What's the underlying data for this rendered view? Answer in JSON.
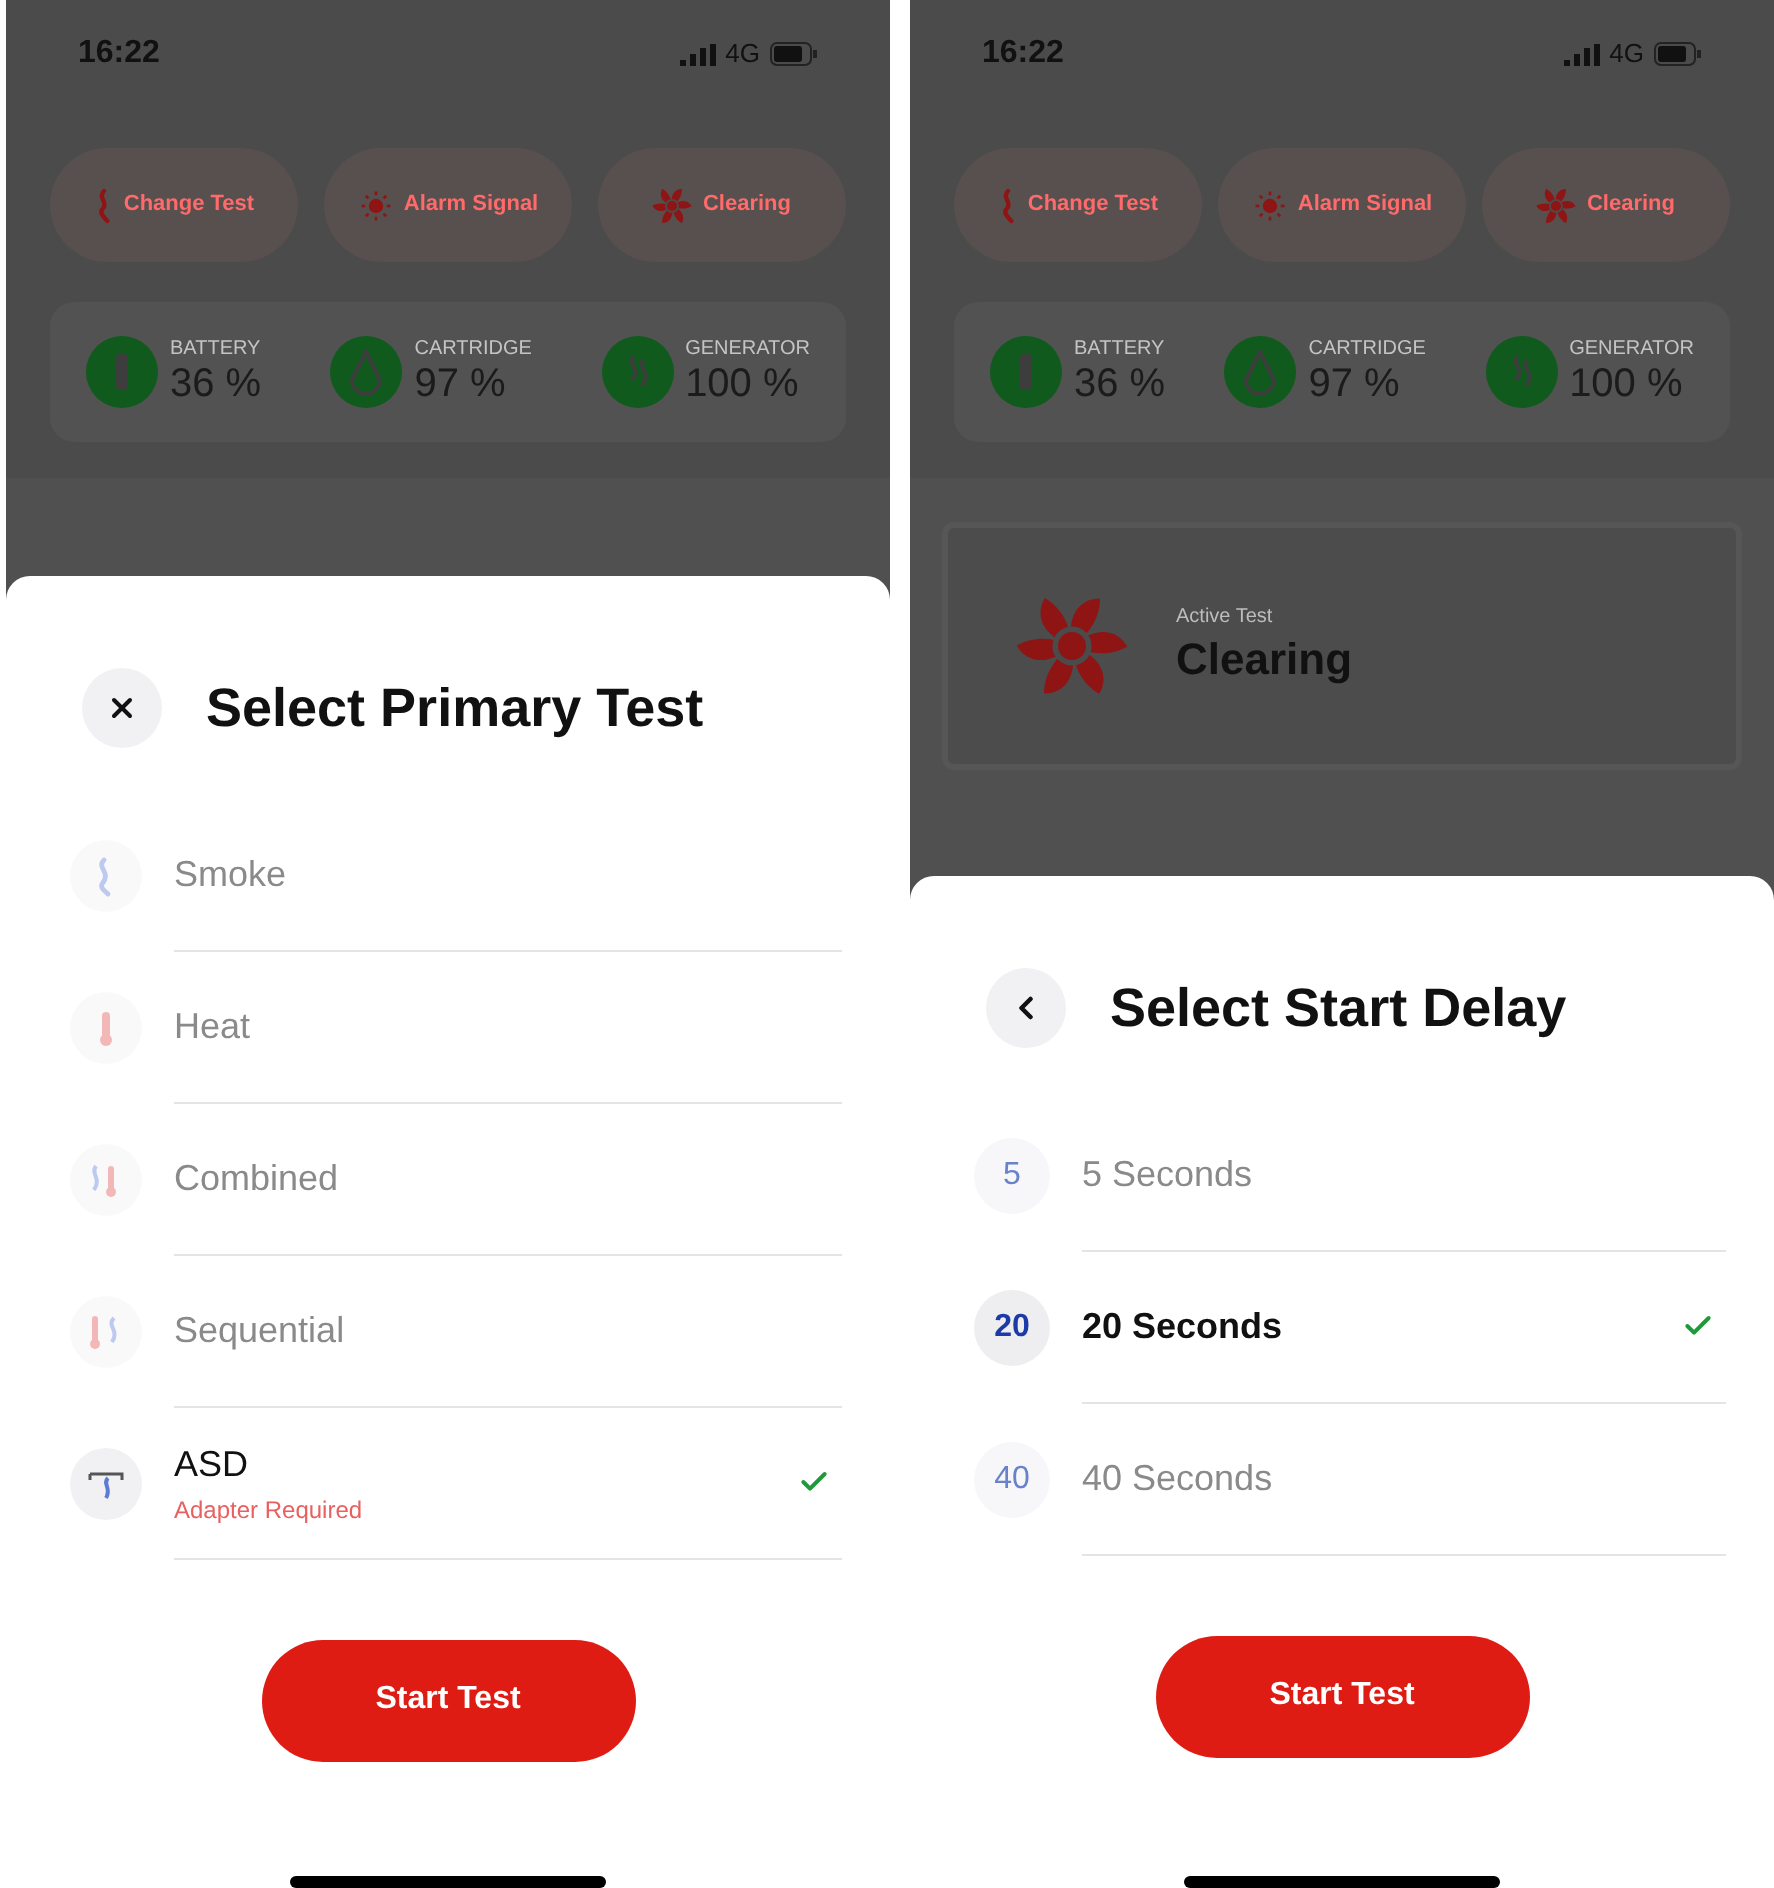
{
  "screens": [
    {
      "status_bar": {
        "time": "16:22",
        "network": "4G"
      },
      "action_buttons": [
        {
          "label": "Change Test"
        },
        {
          "label": "Alarm Signal"
        },
        {
          "label": "Clearing"
        }
      ],
      "stats": [
        {
          "label": "BATTERY",
          "value": "36 %"
        },
        {
          "label": "CARTRIDGE",
          "value": "97 %"
        },
        {
          "label": "GENERATOR",
          "value": "100 %"
        }
      ],
      "sheet": {
        "title": "Select Primary Test",
        "options": [
          {
            "kind": "test",
            "label": "Smoke",
            "selected": false
          },
          {
            "kind": "test",
            "label": "Heat",
            "selected": false
          },
          {
            "kind": "test",
            "label": "Combined",
            "selected": false
          },
          {
            "kind": "test",
            "label": "Sequential",
            "selected": false
          },
          {
            "kind": "test",
            "label": "ASD",
            "note": "Adapter Required",
            "selected": true
          }
        ],
        "button": "Start Test"
      }
    },
    {
      "status_bar": {
        "time": "16:22",
        "network": "4G"
      },
      "action_buttons": [
        {
          "label": "Change Test"
        },
        {
          "label": "Alarm Signal"
        },
        {
          "label": "Clearing"
        }
      ],
      "stats": [
        {
          "label": "BATTERY",
          "value": "36 %"
        },
        {
          "label": "CARTRIDGE",
          "value": "97 %"
        },
        {
          "label": "GENERATOR",
          "value": "100 %"
        }
      ],
      "active_test": {
        "caption": "Active Test",
        "name": "Clearing"
      },
      "sheet": {
        "title": "Select Start Delay",
        "options": [
          {
            "kind": "delay",
            "badge": "5",
            "label": "5 Seconds",
            "selected": false
          },
          {
            "kind": "delay",
            "badge": "20",
            "label": "20 Seconds",
            "selected": true
          },
          {
            "kind": "delay",
            "badge": "40",
            "label": "40 Seconds",
            "selected": false
          }
        ],
        "button": "Start Test"
      }
    }
  ]
}
